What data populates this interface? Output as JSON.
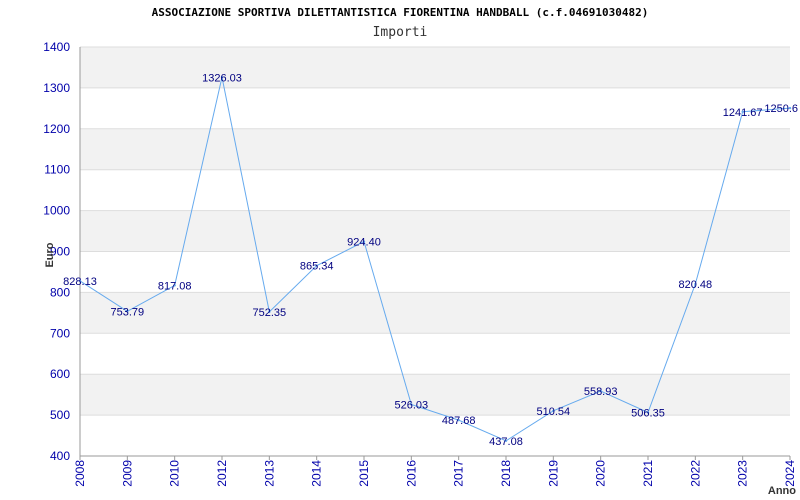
{
  "chart_data": {
    "type": "line",
    "title": "ASSOCIAZIONE SPORTIVA DILETTANTISTICA FIORENTINA HANDBALL (c.f.04691030482)",
    "subtitle": "Importi",
    "xlabel": "Anno",
    "ylabel": "Euro",
    "ylim": [
      400,
      1400
    ],
    "yticks": [
      400,
      500,
      600,
      700,
      800,
      900,
      1000,
      1100,
      1200,
      1300,
      1400
    ],
    "grid": true,
    "categories": [
      "2008",
      "2009",
      "2010",
      "2012",
      "2013",
      "2014",
      "2015",
      "2016",
      "2017",
      "2018",
      "2019",
      "2020",
      "2021",
      "2022",
      "2023",
      "2024"
    ],
    "series": [
      {
        "values": [
          828.13,
          753.79,
          817.08,
          1326.03,
          752.35,
          865.34,
          924.4,
          526.03,
          487.68,
          437.08,
          510.54,
          558.93,
          506.35,
          820.48,
          1241.67,
          1250.6
        ],
        "labels": [
          "828.13",
          "753.79",
          "817.08",
          "1326.03",
          "752.35",
          "865.34",
          "924.40",
          "526.03",
          "487.68",
          "437.08",
          "510.54",
          "558.93",
          "506.35",
          "820.48",
          "1241.67",
          "1250.6"
        ],
        "color": "#66aaee"
      }
    ]
  }
}
